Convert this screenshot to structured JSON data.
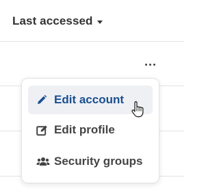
{
  "column_header": {
    "sort_label": "Last accessed",
    "sort_icon": "caret-down-icon"
  },
  "row_actions": {
    "more_icon": "more-horizontal-icon"
  },
  "menu": {
    "items": [
      {
        "label": "Edit account",
        "icon": "pencil-icon",
        "state": "hovered"
      },
      {
        "label": "Edit profile",
        "icon": "edit-square-icon",
        "state": "default"
      },
      {
        "label": "Security groups",
        "icon": "users-icon",
        "state": "default"
      }
    ]
  },
  "colors": {
    "accent": "#1a4f8f",
    "text": "#444444",
    "hover_bg": "#eef0f4",
    "border": "#e3e3e3"
  },
  "cursor": {
    "icon": "hand-pointer-icon"
  }
}
